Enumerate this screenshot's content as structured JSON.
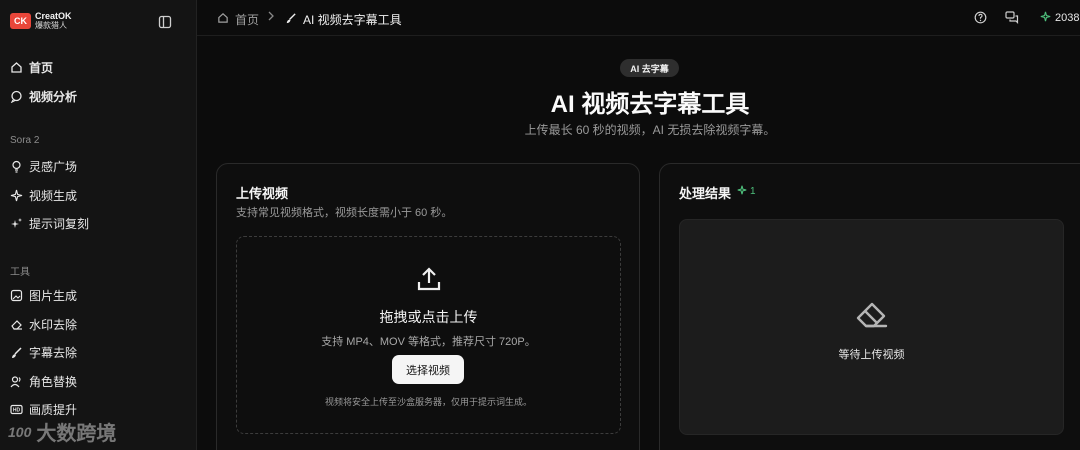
{
  "brand": {
    "name_en": "CreatOK",
    "name_cn": "爆款猎人",
    "mark": "CK"
  },
  "sidebar": {
    "top_items": [
      {
        "label": "首页",
        "icon": "home-icon"
      },
      {
        "label": "视频分析",
        "icon": "chat-bubble-icon"
      }
    ],
    "section_sora": "Sora 2",
    "sora_items": [
      {
        "label": "灵感广场",
        "icon": "lightbulb-icon"
      },
      {
        "label": "视频生成",
        "icon": "sparkle-icon"
      },
      {
        "label": "提示词复刻",
        "icon": "sparkles-icon"
      }
    ],
    "section_tools": "工具",
    "tool_items": [
      {
        "label": "图片生成",
        "icon": "image-icon"
      },
      {
        "label": "水印去除",
        "icon": "eraser-icon"
      },
      {
        "label": "字幕去除",
        "icon": "brush-icon"
      },
      {
        "label": "角色替换",
        "icon": "users-icon"
      },
      {
        "label": "画质提升",
        "icon": "hd-icon"
      }
    ]
  },
  "watermark": {
    "text": "大数跨境",
    "logo": "100"
  },
  "breadcrumb": {
    "home": "首页",
    "current": "AI 视频去字幕工具"
  },
  "topbar": {
    "credits": "2038"
  },
  "hero": {
    "badge": "AI 去字幕",
    "title": "AI 视频去字幕工具",
    "subtitle": "上传最长 60 秒的视频，AI 无损去除视频字幕。"
  },
  "upload_card": {
    "title": "上传视频",
    "desc": "支持常见视频格式，视频长度需小于 60 秒。",
    "drop_title": "拖拽或点击上传",
    "drop_sub": "支持 MP4、MOV 等格式，推荐尺寸 720P。",
    "button": "选择视频",
    "note": "视频将安全上传至沙盒服务器，仅用于提示词生成。"
  },
  "result_card": {
    "title": "处理结果",
    "count": "1",
    "empty_text": "等待上传视频"
  },
  "colors": {
    "accent_green": "#4ec07c",
    "brand_red": "#e8463a"
  }
}
